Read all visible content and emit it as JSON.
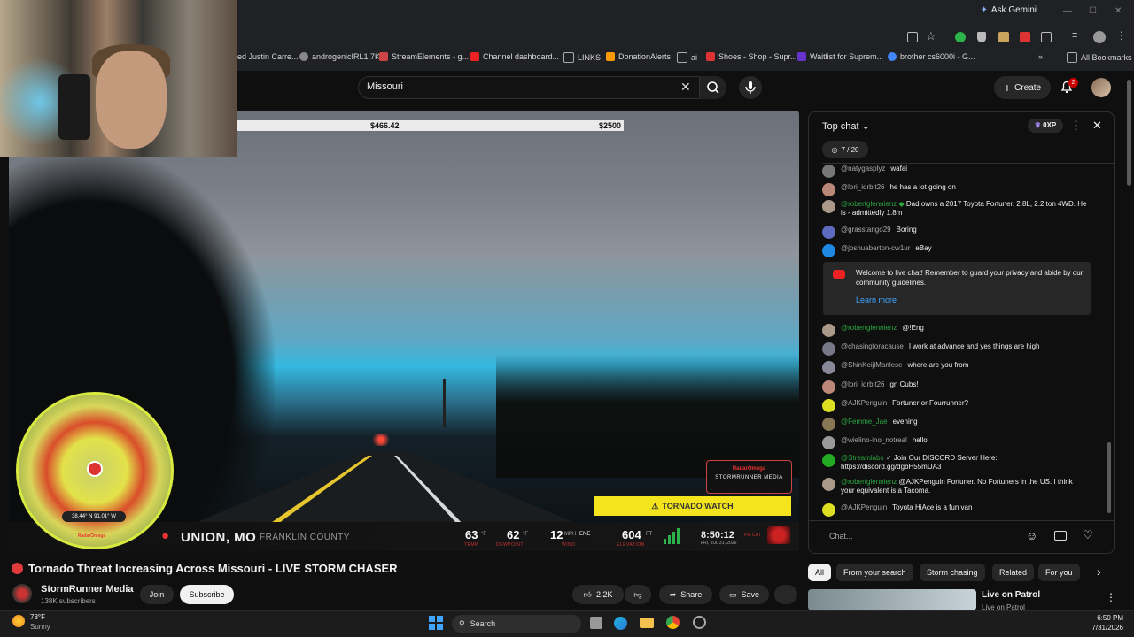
{
  "browser": {
    "ask_gemini": "Ask Gemini",
    "bookmarks": [
      {
        "label": "ed Justin Carre...",
        "color": "#444"
      },
      {
        "label": "androgenicIRL1.7K",
        "color": "#888"
      },
      {
        "label": "StreamElements - g...",
        "color": "#c44"
      },
      {
        "label": "Channel dashboard...",
        "color": "#e22"
      },
      {
        "label": "LINKS",
        "color": "#aaa"
      },
      {
        "label": "DonationAlerts",
        "color": "#f90"
      },
      {
        "label": "ai",
        "color": "#aaa"
      },
      {
        "label": "Shoes - Shop - Supr...",
        "color": "#d33"
      },
      {
        "label": "Waitlist for Suprem...",
        "color": "#63c"
      },
      {
        "label": "brother cs6000i - G...",
        "color": "#4285f4"
      }
    ],
    "all_bookmarks": "All Bookmarks"
  },
  "youtube": {
    "search_value": "Missouri",
    "create_label": "Create",
    "notification_count": "2"
  },
  "video": {
    "donation_left": "$466.42",
    "donation_right": "$2500",
    "location": "UNION, MO",
    "county": "FRANKLIN COUNTY",
    "temp": {
      "value": "63",
      "unit": "°F",
      "label": "TEMP"
    },
    "dewpoint": {
      "value": "62",
      "unit": "°F",
      "label": "DEWPOINT"
    },
    "wind": {
      "value": "12",
      "unit": "MPH",
      "dir": "ENE",
      "label": "WIND"
    },
    "elevation": {
      "value": "604",
      "unit": "FT",
      "label": "ELEVATION"
    },
    "clock": "8:50:12",
    "clock_tz": "PM CDT",
    "date": "FRI, JUL 31, 2026",
    "coords": "38.44° N 91.01° W",
    "tornado_watch": "TORNADO WATCH",
    "radar_brand": "RadarOmega",
    "radar_sub": "STORMRUNNER MEDIA"
  },
  "watch": {
    "title": "Tornado Threat Increasing Across Missouri - LIVE STORM CHASER",
    "channel": "StormRunner Media",
    "subs": "138K subscribers",
    "join": "Join",
    "subscribe": "Subscribe",
    "likes": "2.2K",
    "share": "Share",
    "save": "Save"
  },
  "chat": {
    "mode": "Top chat",
    "xp": "0XP",
    "goal": "7 / 20",
    "messages_top": [
      {
        "author": "@natygasplyz",
        "text": "wafai",
        "color": "#777",
        "member": false
      },
      {
        "author": "@lori_idrbit26",
        "text": "he has a lot going on",
        "color": "#b87",
        "member": false
      },
      {
        "author": "@robertglennienz",
        "text": "Dad owns a 2017 Toyota Fortuner. 2.8L, 2.2 ton 4WD. He is - admittedly 1.8m",
        "color": "#a98",
        "member": true
      },
      {
        "author": "@grasstango29",
        "text": "Boring",
        "color": "#5c6bc0",
        "member": false
      },
      {
        "author": "@joshuabarton-cw1ur",
        "text": "eBay",
        "color": "#1e88e5",
        "member": false
      }
    ],
    "welcome": "Welcome to live chat! Remember to guard your privacy and abide by our community guidelines.",
    "learn_more": "Learn more",
    "messages_bottom": [
      {
        "author": "@robertglennienz",
        "text": "@!Eng",
        "color": "#a98",
        "member": true
      },
      {
        "author": "@chasingforacause",
        "text": "I work at advance and yes things are high",
        "color": "#778",
        "member": false
      },
      {
        "author": "@ShinKeijiManlese",
        "text": "where are you from",
        "color": "#889",
        "member": false
      },
      {
        "author": "@lori_idrbit26",
        "text": "gn Cubs!",
        "color": "#b87",
        "member": false
      },
      {
        "author": "@AJKPenguin",
        "text": "Fortuner or Fourrunner?",
        "color": "#dd2",
        "member": false
      },
      {
        "author": "@Femme_Jae",
        "text": "evening",
        "color": "#875",
        "member": true
      },
      {
        "author": "@wielino-ino_notreal",
        "text": "hello",
        "color": "#999",
        "member": false
      },
      {
        "author": "@Streamlabs",
        "text": "Join Our DISCORD Server Here: https://discord.gg/dgbH55mUA3",
        "color": "#2a2",
        "member": true
      },
      {
        "author": "@robertglennienz",
        "text": "@AJKPenguin Fortuner. No Fortuners in the US. I think your equivalent is a Tacoma.",
        "color": "#a98",
        "member": true
      },
      {
        "author": "@AJKPenguin",
        "text": "Toyota HiAce is a fun van",
        "color": "#dd2",
        "member": false
      }
    ],
    "input_placeholder": "Chat..."
  },
  "chips": [
    "All",
    "From your search",
    "Storm chasing",
    "Related",
    "For you"
  ],
  "recommendation": {
    "title": "Live on Patrol",
    "sub": "Live on Patrol"
  },
  "taskbar": {
    "weather_temp": "78°F",
    "weather_desc": "Sunny",
    "search": "Search",
    "time": "6:50 PM",
    "date": "7/31/2026"
  }
}
